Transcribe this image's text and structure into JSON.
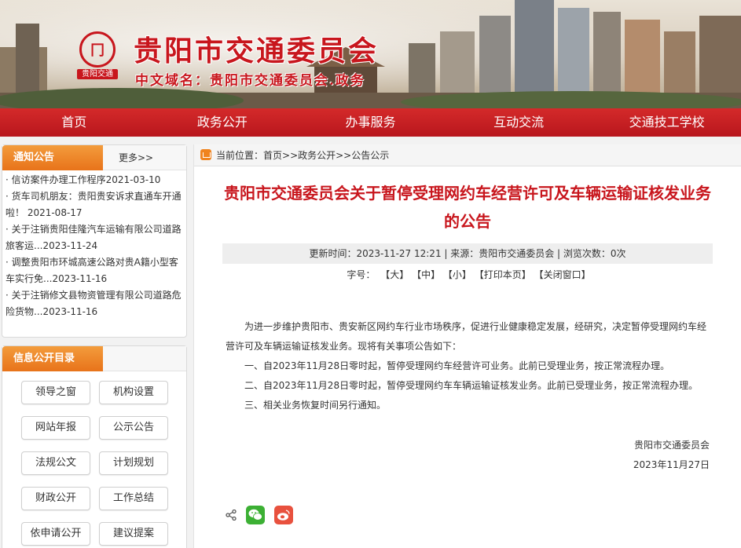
{
  "header": {
    "logo_text": "贵阳交通",
    "title": "贵阳市交通委员会",
    "domain": "中文域名：贵阳市交通委员会.政务"
  },
  "nav": [
    "首页",
    "政务公开",
    "办事服务",
    "互动交流",
    "交通技工学校"
  ],
  "notice": {
    "title": "通知公告",
    "more": "更多>>",
    "items": [
      "· 信访案件办理工作程序2021-03-10",
      "· 货车司机朋友：贵阳贵安诉求直通车开通啦！ 2021-08-17",
      "· 关于注销贵阳佳隆汽车运输有限公司道路旅客运...2023-11-24",
      "· 调整贵阳市环城高速公路对贵A籍小型客车实行免...2023-11-16",
      "· 关于注销修文县物资管理有限公司道路危险货物...2023-11-16"
    ]
  },
  "catalog": {
    "title": "信息公开目录",
    "buttons": [
      "领导之窗",
      "机构设置",
      "网站年报",
      "公示公告",
      "法规公文",
      "计划规划",
      "财政公开",
      "工作总结",
      "依申请公开",
      "建议提案"
    ]
  },
  "breadcrumb": {
    "label": "当前位置：",
    "path": "首页>>政务公开>>公告公示"
  },
  "article": {
    "title": "贵阳市交通委员会关于暂停受理网约车经营许可及车辆运输证核发业务的公告",
    "meta": "更新时间：2023-11-27 12:21 | 来源：贵阳市交通委员会 | 浏览次数：0次",
    "font_label": "字号：",
    "font_big": "【大】",
    "font_mid": "【中】",
    "font_small": "【小】",
    "print": "【打印本页】",
    "close": "【关闭窗口】",
    "intro": "为进一步维护贵阳市、贵安新区网约车行业市场秩序，促进行业健康稳定发展，经研究，决定暂停受理网约车经营许可及车辆运输证核发业务。现将有关事项公告如下：",
    "items": [
      "一、自2023年11月28日零时起，暂停受理网约车经营许可业务。此前已受理业务，按正常流程办理。",
      "二、自2023年11月28日零时起，暂停受理网约车车辆运输证核发业务。此前已受理业务，按正常流程办理。",
      "三、相关业务恢复时间另行通知。"
    ],
    "signature": "贵阳市交通委员会",
    "date": "2023年11月27日"
  },
  "share": {
    "icons": [
      "share-icon",
      "wechat-icon",
      "weibo-icon"
    ]
  },
  "colors": {
    "brand_red": "#c8161d",
    "tab_orange": "#e8731a",
    "wechat_green": "#3cb034",
    "weibo_red": "#e8513e"
  }
}
